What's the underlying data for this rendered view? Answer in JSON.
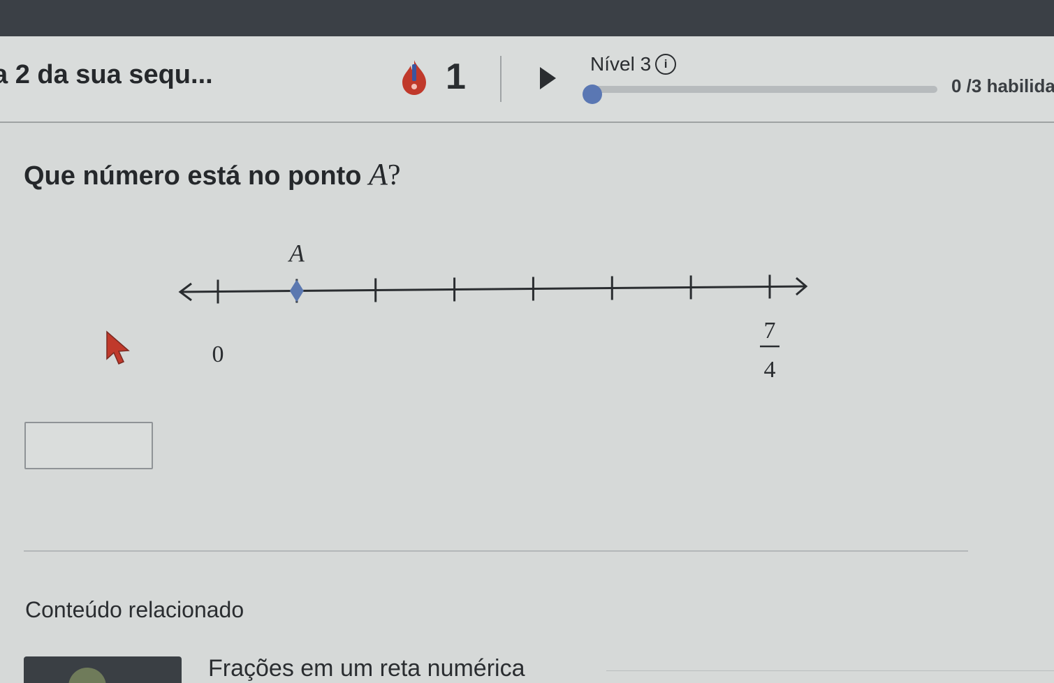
{
  "header": {
    "sequence_title": "a 2 da sua sequ...",
    "streak_count": "1",
    "level_label": "Nível 3",
    "info_icon": "i",
    "skills_text": "0 /3 habilida",
    "progress_fraction": 0.0
  },
  "question": {
    "prefix": "Que número está no ponto ",
    "variable": "A",
    "suffix": "?"
  },
  "number_line": {
    "point_label": "A",
    "point_tick_index": 1,
    "tick_count": 8,
    "label_start": "0",
    "label_end_numerator": "7",
    "label_end_denominator": "4",
    "point_color": "#5b78b0"
  },
  "answer": {
    "value": "",
    "placeholder": ""
  },
  "related": {
    "title": "Conteúdo relacionado",
    "link_text": "Frações em um reta numérica"
  },
  "colors": {
    "topbar": "#3b4046",
    "accent": "#5a77b3",
    "streak": "#c0392b"
  },
  "icons": {
    "streak": "flame-icon",
    "play": "play-icon",
    "info": "info-icon",
    "cursor": "cursor-arrow-icon"
  }
}
